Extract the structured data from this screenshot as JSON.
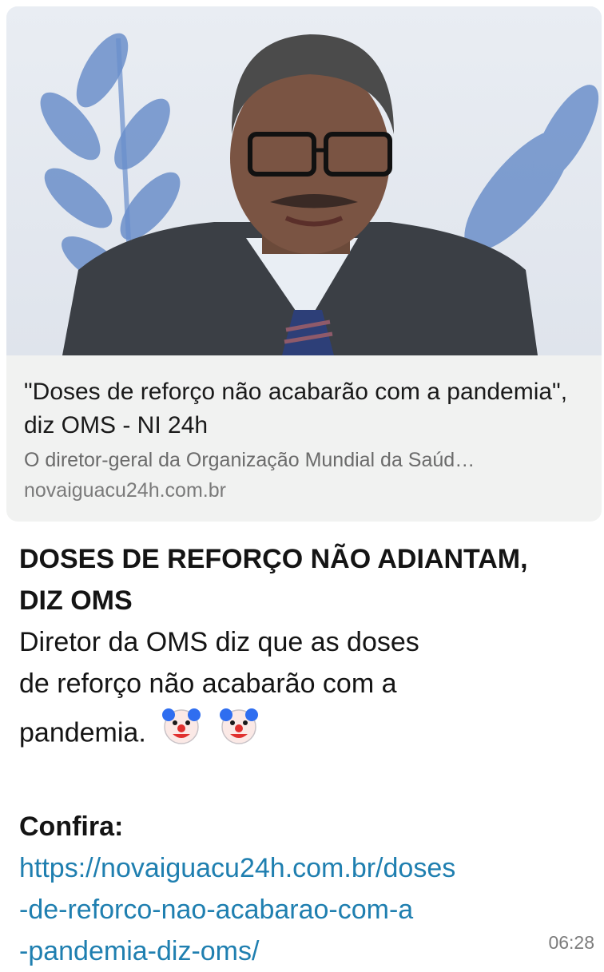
{
  "link_preview": {
    "title": "\"Doses de reforço não acabarão com a pandemia\", diz OMS - NI 24h",
    "description": "O diretor-geral da Organização Mundial da Saúd…",
    "domain": "novaiguacu24h.com.br",
    "image_icon": "man-with-glasses-photo"
  },
  "message": {
    "headline_line1": "DOSES DE REFORÇO NÃO ADIANTAM,",
    "headline_line2": "DIZ OMS",
    "body_line1": "Diretor da OMS diz que as doses",
    "body_line2": "de reforço não acabarão com a",
    "body_line3": "pandemia.",
    "emoji_icon": "clown-face-icon",
    "confira_label": "Confira:",
    "link_line1": "https://novaiguacu24h.com.br/doses",
    "link_line2": "-de-reforco-nao-acabarao-com-a",
    "link_line3": "-pandemia-diz-oms/",
    "time": "06:28"
  },
  "colors": {
    "link": "#1f7fb0",
    "preview_bg": "#f1f2f1",
    "text": "#141414"
  }
}
